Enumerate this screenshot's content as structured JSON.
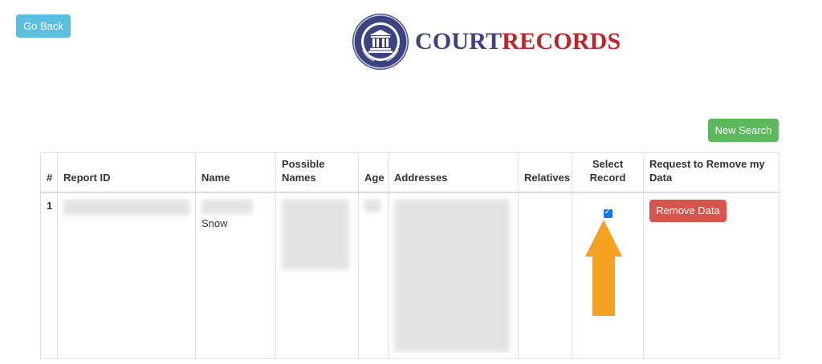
{
  "nav": {
    "go_back_label": "Go Back"
  },
  "logo": {
    "brand_part1": "COURT",
    "brand_part2": "RECORDS",
    "seal_text": "COURT RECORDS"
  },
  "actions": {
    "new_search_label": "New Search"
  },
  "table": {
    "headers": [
      "#",
      "Report ID",
      "Name",
      "Possible Names",
      "Age",
      "Addresses",
      "Relatives",
      "Select Record",
      "Request to Remove my Data"
    ],
    "rows": [
      {
        "index": "1",
        "name_visible": "Snow",
        "selected": true,
        "remove_label": "Remove Data"
      }
    ]
  },
  "colors": {
    "go_back": "#5bc0de",
    "new_search": "#5cb85c",
    "remove": "#d9534f",
    "arrow": "#f5a223",
    "brand_blue": "#3c4380",
    "brand_red": "#c0242b"
  },
  "icons": {
    "seal": "court-seal-icon",
    "arrow": "up-arrow-icon",
    "checkbox": "checkbox-checked-icon"
  }
}
